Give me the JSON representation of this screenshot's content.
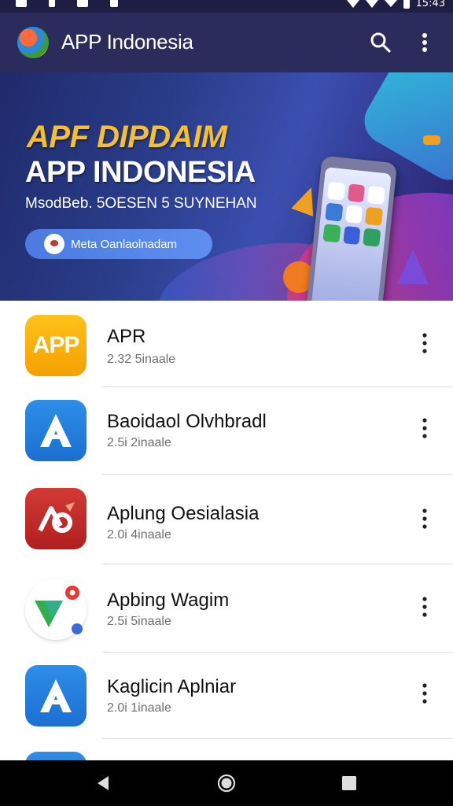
{
  "status_bar": {
    "time": "15:43"
  },
  "app_bar": {
    "title": "APP Indonesia",
    "logo_icon": "app-logo-icon",
    "search_icon": "search-icon",
    "more_icon": "more-vert-icon"
  },
  "banner": {
    "headline1": "APF DIPDAIM",
    "headline2": "APP INDONESIA",
    "subtitle": "MsodBeb. 5OESEN 5 SUYNEHAN",
    "pill_label": "Meta Oanlaolnadam"
  },
  "apps": [
    {
      "name": "APR",
      "meta": "2.32 5inaale",
      "icon": "app-icon",
      "icon_text": "APP"
    },
    {
      "name": "Baoidaol Olvhbradl",
      "meta": "2.5i 2inaale",
      "icon": "a-logo-icon"
    },
    {
      "name": "Aplung Oesialasia",
      "meta": "2.0i 4inaale",
      "icon": "red-ab-icon"
    },
    {
      "name": "Apbing Wagim",
      "meta": "2.5i 5inaale",
      "icon": "maps-icon"
    },
    {
      "name": "Kaglicin Aplniar",
      "meta": "2.0i 1inaale",
      "icon": "a-logo-icon"
    }
  ],
  "colors": {
    "app_bar": "#2c2c5c",
    "status_bar": "#1e1e44",
    "accent_yellow": "#f5c030",
    "accent_blue": "#2d8ee8",
    "accent_red": "#d23a34"
  },
  "nav_bar": {
    "back_icon": "back-icon",
    "home_icon": "home-icon",
    "recents_icon": "recents-icon"
  }
}
